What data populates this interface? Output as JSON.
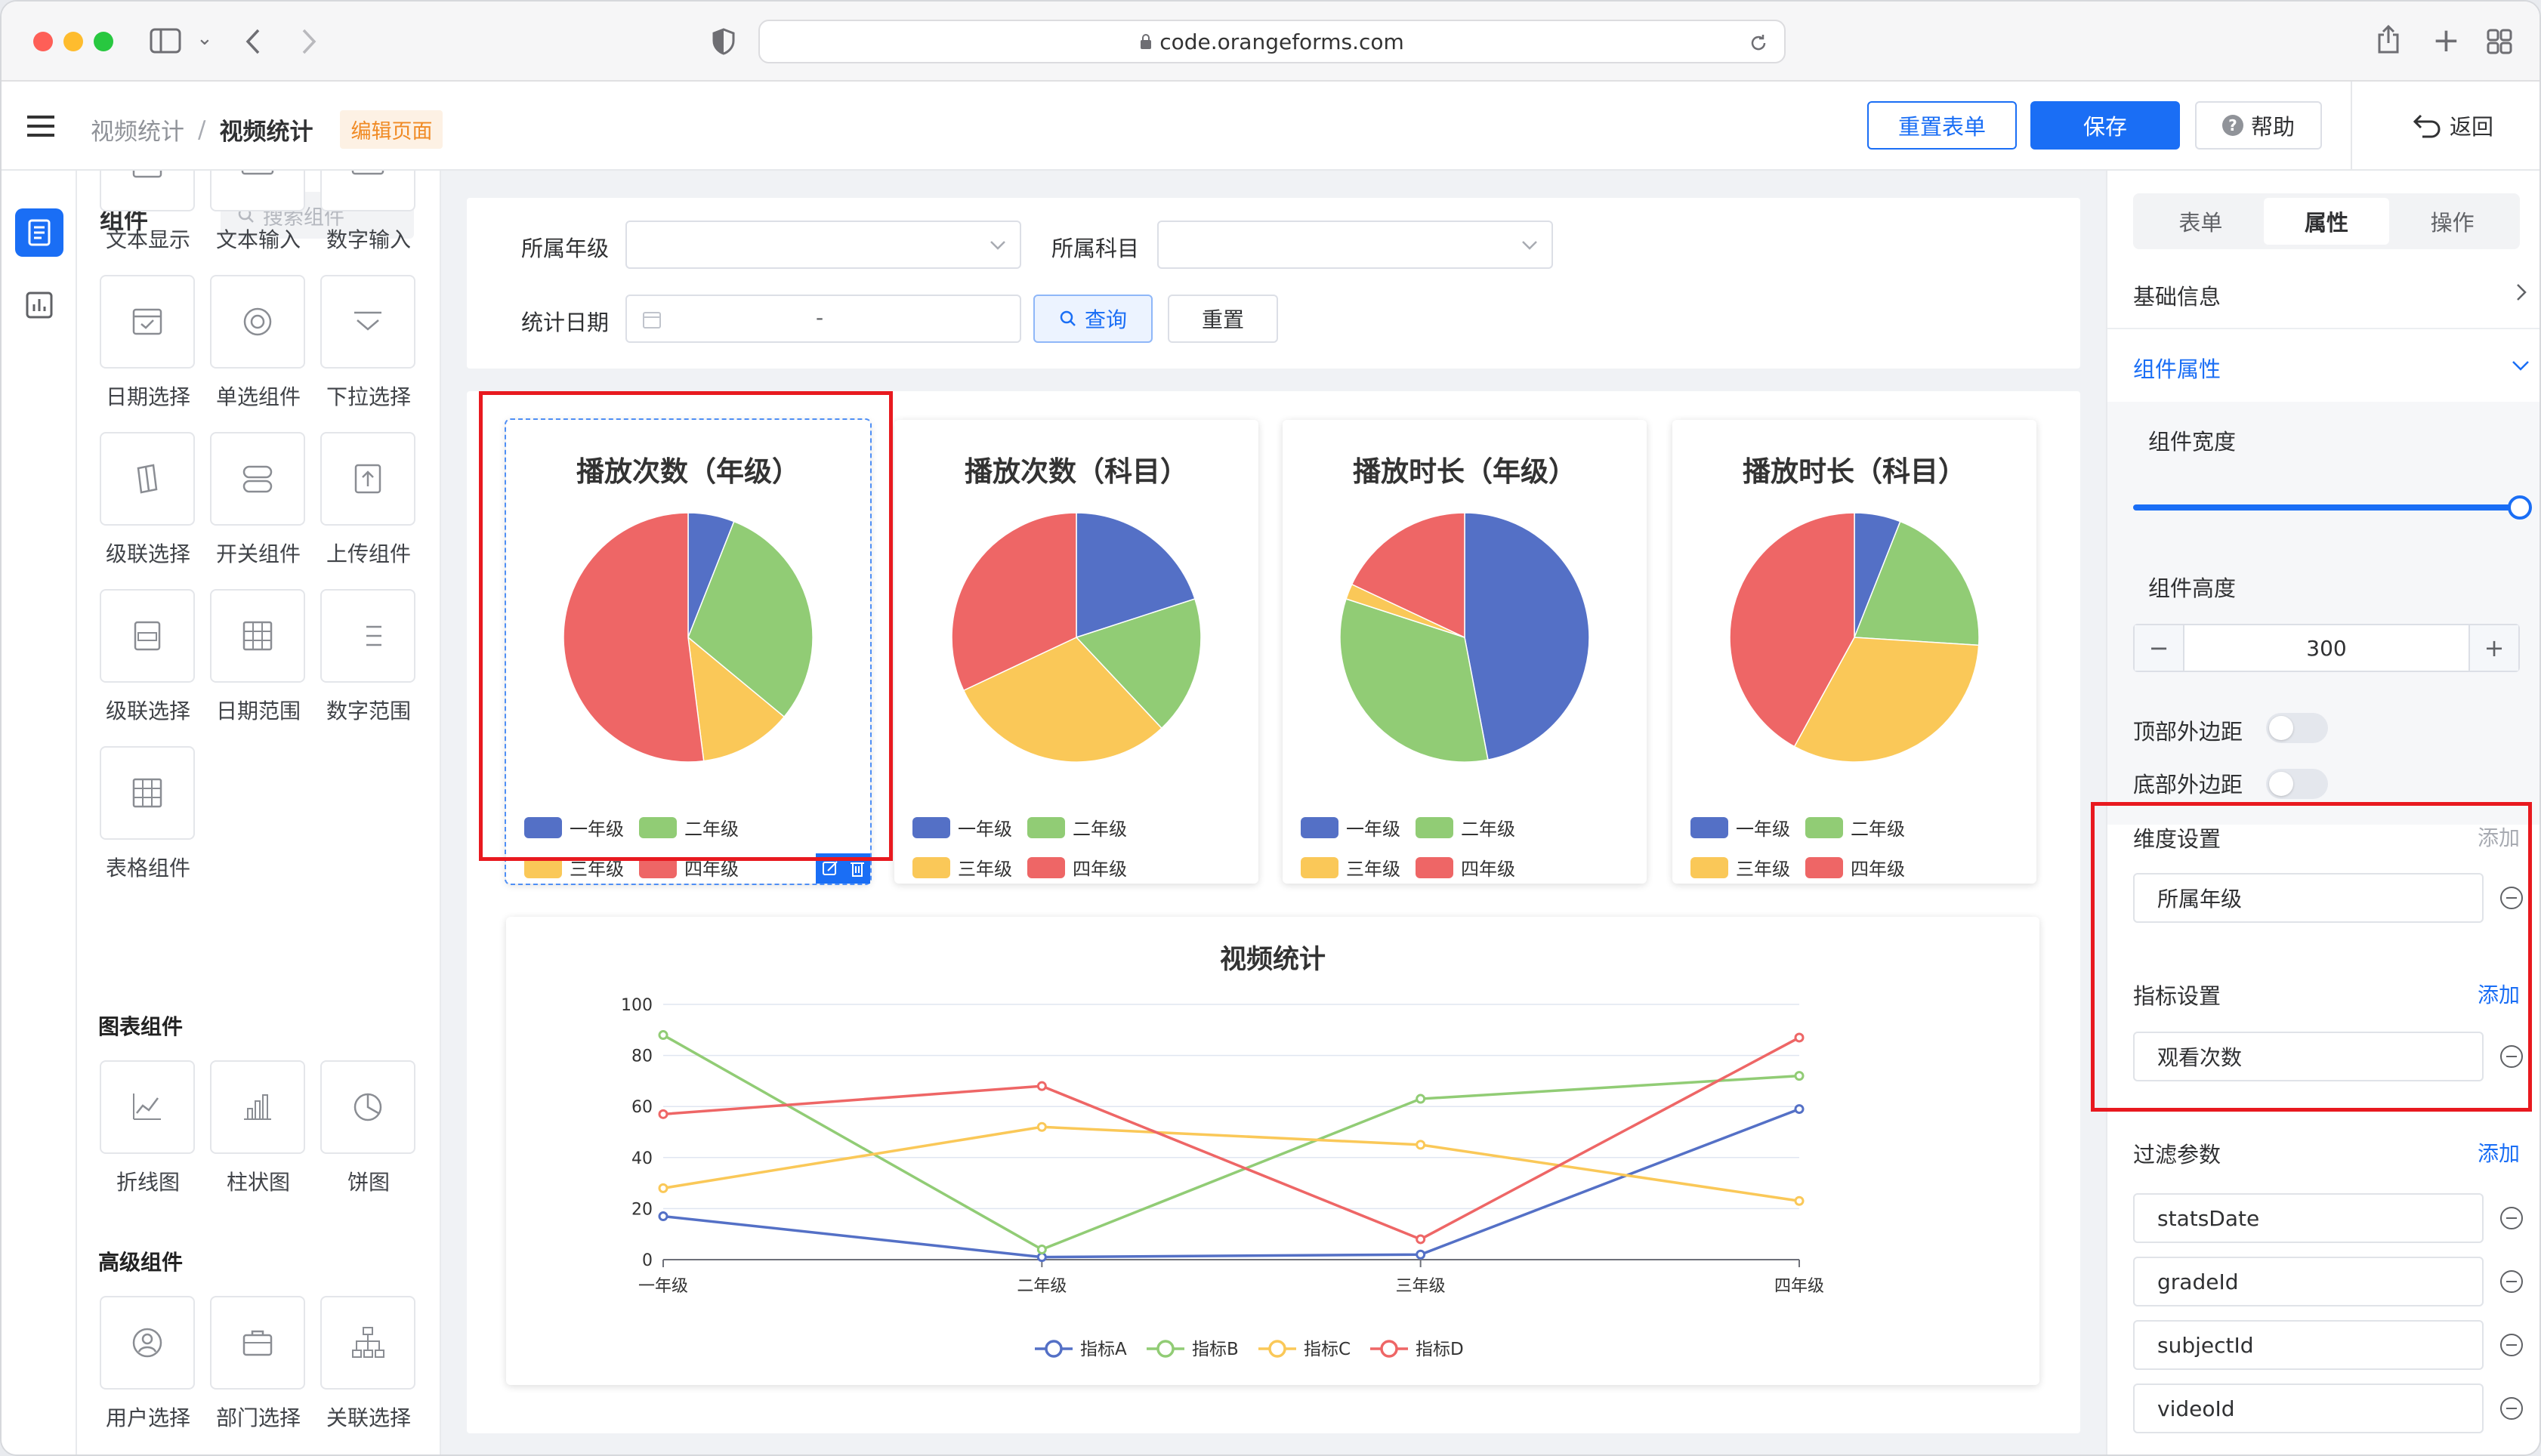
{
  "browser": {
    "url": "code.orangeforms.com"
  },
  "header": {
    "breadcrumb_parent": "视频统计",
    "breadcrumb_sep": "/",
    "breadcrumb_current": "视频统计",
    "mode_badge": "编辑页面",
    "reset_form_label": "重置表单",
    "save_label": "保存",
    "help_label": "帮助",
    "back_label": "返回"
  },
  "palette": {
    "title": "组件",
    "search_placeholder": "搜索组件",
    "basic_items": [
      "文本显示",
      "文本输入",
      "数字输入",
      "日期选择",
      "单选组件",
      "下拉选择",
      "级联选择",
      "开关组件",
      "上传组件",
      "级联选择",
      "日期范围",
      "数字范围",
      "表格组件"
    ],
    "chart_section": "图表组件",
    "chart_items": [
      "折线图",
      "柱状图",
      "饼图"
    ],
    "advanced_section": "高级组件",
    "advanced_items": [
      "用户选择",
      "部门选择",
      "关联选择"
    ]
  },
  "filter": {
    "grade_label": "所属年级",
    "subject_label": "所属科目",
    "date_label": "统计日期",
    "date_separator": "-",
    "query_label": "查询",
    "reset_label": "重置"
  },
  "colors": {
    "blue": "#5470c6",
    "green": "#91cc75",
    "yellow": "#fac858",
    "red": "#ee6666",
    "primary": "#1a6ef5"
  },
  "chart_data": [
    {
      "type": "pie",
      "title": "播放次数（年级）",
      "categories": [
        "一年级",
        "二年级",
        "三年级",
        "四年级"
      ],
      "values": [
        6,
        30,
        12,
        52
      ]
    },
    {
      "type": "pie",
      "title": "播放次数（科目）",
      "categories": [
        "一年级",
        "二年级",
        "三年级",
        "四年级"
      ],
      "values": [
        20,
        18,
        30,
        32
      ]
    },
    {
      "type": "pie",
      "title": "播放时长（年级）",
      "categories": [
        "一年级",
        "二年级",
        "三年级",
        "四年级"
      ],
      "values": [
        47,
        33,
        2,
        18
      ]
    },
    {
      "type": "pie",
      "title": "播放时长（科目）",
      "categories": [
        "一年级",
        "二年级",
        "三年级",
        "四年级"
      ],
      "values": [
        6,
        20,
        32,
        42
      ]
    },
    {
      "type": "line",
      "title": "视频统计",
      "categories": [
        "一年级",
        "二年级",
        "三年级",
        "四年级"
      ],
      "ylim": [
        0,
        100
      ],
      "yticks": [
        0,
        20,
        40,
        60,
        80,
        100
      ],
      "series": [
        {
          "name": "指标A",
          "values": [
            17,
            1,
            2,
            59
          ]
        },
        {
          "name": "指标B",
          "values": [
            88,
            4,
            63,
            72
          ]
        },
        {
          "name": "指标C",
          "values": [
            28,
            52,
            45,
            23
          ]
        },
        {
          "name": "指标D",
          "values": [
            57,
            68,
            8,
            87
          ]
        }
      ]
    }
  ],
  "props": {
    "tabs": [
      "表单",
      "属性",
      "操作"
    ],
    "basic_info": "基础信息",
    "component_props": "组件属性",
    "width_label": "组件宽度",
    "width_value": 1,
    "height_label": "组件高度",
    "height_value": "300",
    "top_margin_label": "顶部外边距",
    "bottom_margin_label": "底部外边距",
    "dimension_label": "维度设置",
    "dimension_add": "添加",
    "dimension_value": "所属年级",
    "metric_label": "指标设置",
    "metric_add": "添加",
    "metric_value": "观看次数",
    "filter_label": "过滤参数",
    "filter_add": "添加",
    "filter_params": [
      "statsDate",
      "gradeId",
      "subjectId",
      "videoId"
    ]
  }
}
